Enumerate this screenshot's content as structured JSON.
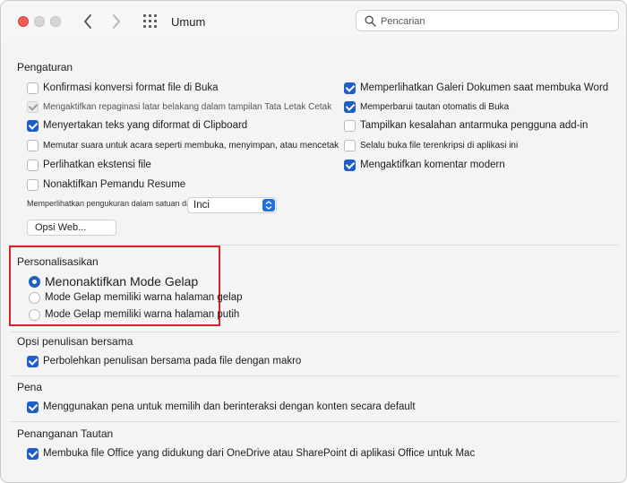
{
  "window": {
    "title": "Umum"
  },
  "search": {
    "placeholder": "Pencarian"
  },
  "pengaturan": {
    "heading": "Pengaturan",
    "left": [
      {
        "label": "Konfirmasi konversi format file di Buka",
        "checked": false
      },
      {
        "label": "Mengaktifkan repaginasi latar belakang dalam tampilan Tata Letak Cetak",
        "checked": true,
        "disabled": true
      },
      {
        "label": "Menyertakan teks yang diformat di Clipboard",
        "checked": true
      },
      {
        "label": "Memutar suara untuk acara seperti membuka, menyimpan, atau mencetak",
        "checked": false
      },
      {
        "label": "Perlihatkan ekstensi file",
        "checked": false
      },
      {
        "label": "Nonaktifkan Pemandu Resume",
        "checked": false
      }
    ],
    "right": [
      {
        "label": "Memperlihatkan Galeri Dokumen saat membuka Word",
        "checked": true
      },
      {
        "label": "Memperbarui tautan otomatis di Buka",
        "checked": true
      },
      {
        "label": "Tampilkan kesalahan antarmuka pengguna add-in",
        "checked": false
      },
      {
        "label": "Selalu buka file terenkripsi di aplikasi ini",
        "checked": false
      },
      {
        "label": "Mengaktifkan komentar modern",
        "checked": true
      }
    ],
    "units_label": "Memperlihatkan pengukuran dalam satuan dari:",
    "units_value": "Inci",
    "web_options_button": "Opsi Web..."
  },
  "personalisasikan": {
    "heading": "Personalisasikan",
    "options": [
      {
        "label": "Menonaktifkan Mode Gelap",
        "selected": true
      },
      {
        "label": "Mode Gelap memiliki warna halaman gelap",
        "selected": false
      },
      {
        "label": "Mode Gelap memiliki warna halaman putih",
        "selected": false
      }
    ]
  },
  "coauthoring": {
    "heading": "Opsi penulisan bersama",
    "item": "Perbolehkan penulisan bersama pada file dengan makro"
  },
  "pen": {
    "heading": "Pena",
    "item": "Menggunakan pena untuk memilih dan berinteraksi dengan konten secara default"
  },
  "links": {
    "heading": "Penanganan Tautan",
    "item": "Membuka file Office yang didukung dari OneDrive atau SharePoint di aplikasi Office untuk Mac"
  },
  "colors": {
    "accent": "#1f5fc5",
    "highlight": "#d8232a",
    "close": "#ec5f59"
  }
}
